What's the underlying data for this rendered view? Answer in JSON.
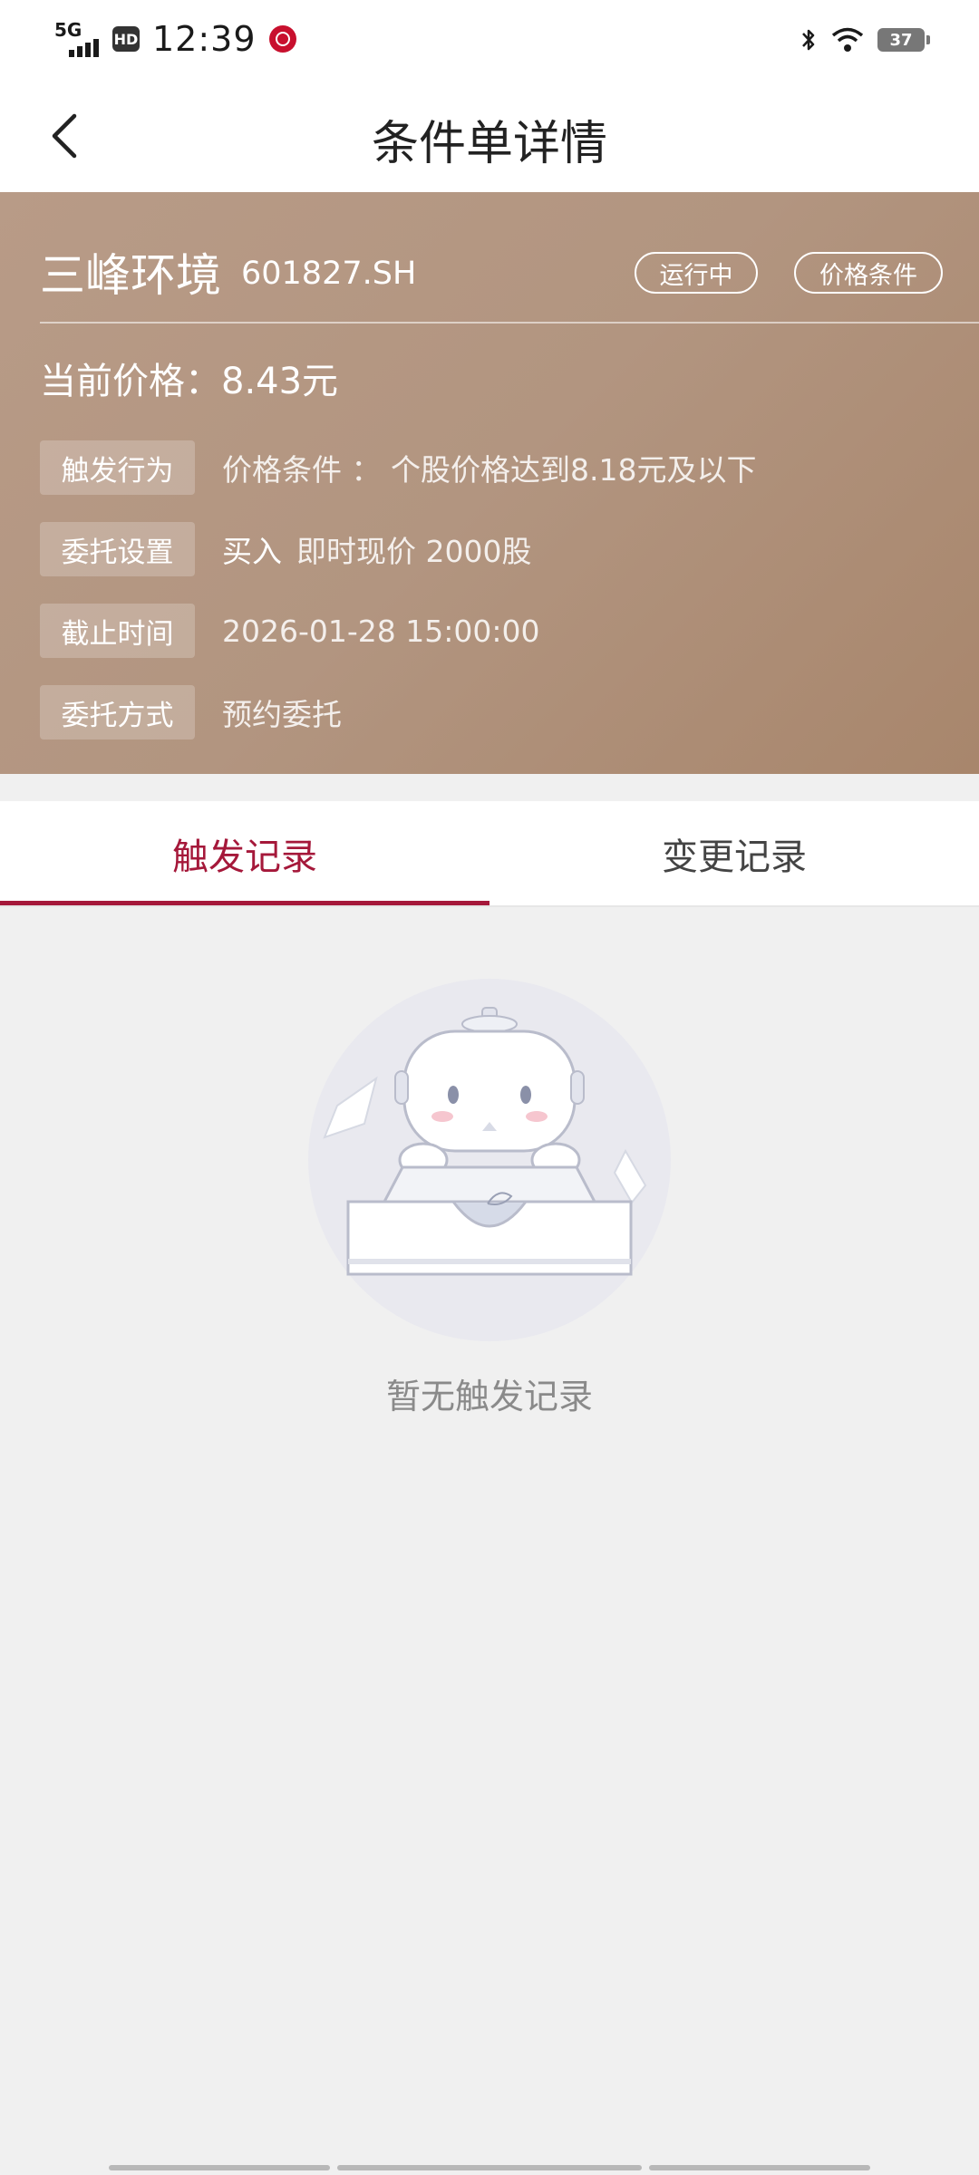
{
  "status_bar": {
    "network": "5G",
    "hd": "HD",
    "time": "12:39",
    "battery": "37"
  },
  "header": {
    "title": "条件单详情"
  },
  "card": {
    "stock_name": "三峰环境",
    "stock_code": "601827.SH",
    "status_pill": "运行中",
    "type_pill": "价格条件",
    "current_price": "当前价格：8.43元",
    "rows": [
      {
        "label": "触发行为",
        "value": "价格条件 ： 个股价格达到8.18元及以下"
      },
      {
        "label": "委托设置",
        "action": "买入",
        "value": "即时现价  2000股"
      },
      {
        "label": "截止时间",
        "value": "2026-01-28  15:00:00"
      },
      {
        "label": "委托方式",
        "value": "预约委托"
      }
    ]
  },
  "tabs": [
    {
      "label": "触发记录",
      "active": true
    },
    {
      "label": "变更记录",
      "active": false
    }
  ],
  "empty_state": {
    "text": "暂无触发记录"
  },
  "colors": {
    "accent": "#a5183a",
    "card_bg": "#b29580"
  }
}
